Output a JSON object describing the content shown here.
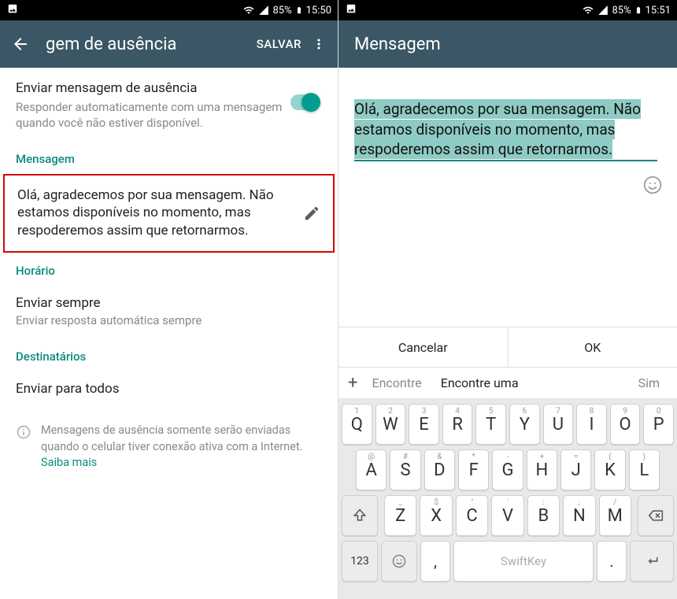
{
  "left": {
    "status": {
      "battery": "85%",
      "time": "15:50"
    },
    "appbar": {
      "title": "gem de ausência",
      "action": "SALVAR"
    },
    "toggle": {
      "title": "Enviar mensagem de ausência",
      "sub": "Responder automaticamente com uma mensagem quando você não estiver disponível."
    },
    "section_msg": "Mensagem",
    "message_text": "Olá, agradecemos por sua mensagem. Não estamos disponíveis no momento, mas respoderemos assim que retornarmos.",
    "section_time": "Horário",
    "schedule": {
      "title": "Enviar sempre",
      "sub": "Enviar resposta automática sempre"
    },
    "section_recip": "Destinatários",
    "recip": {
      "title": "Enviar para todos"
    },
    "info": "Mensagens de ausência somente serão enviadas quando o celular tiver conexão ativa com a Internet. ",
    "info_link": "Saiba mais"
  },
  "right": {
    "status": {
      "battery": "85%",
      "time": "15:51"
    },
    "appbar": {
      "title": "Mensagem"
    },
    "edit_text": "Olá, agradecemos por sua mensagem. Não estamos disponíveis no momento, mas respoderemos assim que retornarmos.",
    "buttons": {
      "cancel": "Cancelar",
      "ok": "OK"
    },
    "suggestions": {
      "s1": "Encontre",
      "s2": "Encontre uma",
      "s3": "Sim"
    },
    "keyboard": {
      "row1": [
        {
          "main": "Q",
          "alt": "1"
        },
        {
          "main": "W",
          "alt": "2"
        },
        {
          "main": "E",
          "alt": "3"
        },
        {
          "main": "R",
          "alt": "4"
        },
        {
          "main": "T",
          "alt": "5"
        },
        {
          "main": "Y",
          "alt": "6"
        },
        {
          "main": "U",
          "alt": "7"
        },
        {
          "main": "I",
          "alt": "8"
        },
        {
          "main": "O",
          "alt": "9"
        },
        {
          "main": "P",
          "alt": "0"
        }
      ],
      "row2": [
        {
          "main": "A",
          "alt": "@"
        },
        {
          "main": "S",
          "alt": "#"
        },
        {
          "main": "D",
          "alt": "&"
        },
        {
          "main": "F",
          "alt": "*"
        },
        {
          "main": "G",
          "alt": "-"
        },
        {
          "main": "H",
          "alt": "+"
        },
        {
          "main": "J",
          "alt": "="
        },
        {
          "main": "K",
          "alt": "("
        },
        {
          "main": "L",
          "alt": ")"
        }
      ],
      "row3": [
        {
          "main": "Z",
          "alt": "_"
        },
        {
          "main": "X",
          "alt": "$"
        },
        {
          "main": "C",
          "alt": "\""
        },
        {
          "main": "V",
          "alt": "'"
        },
        {
          "main": "B",
          "alt": ":"
        },
        {
          "main": "N",
          "alt": ";"
        },
        {
          "main": "M",
          "alt": "/"
        }
      ],
      "num_label": "123",
      "space_label": "SwiftKey"
    }
  }
}
